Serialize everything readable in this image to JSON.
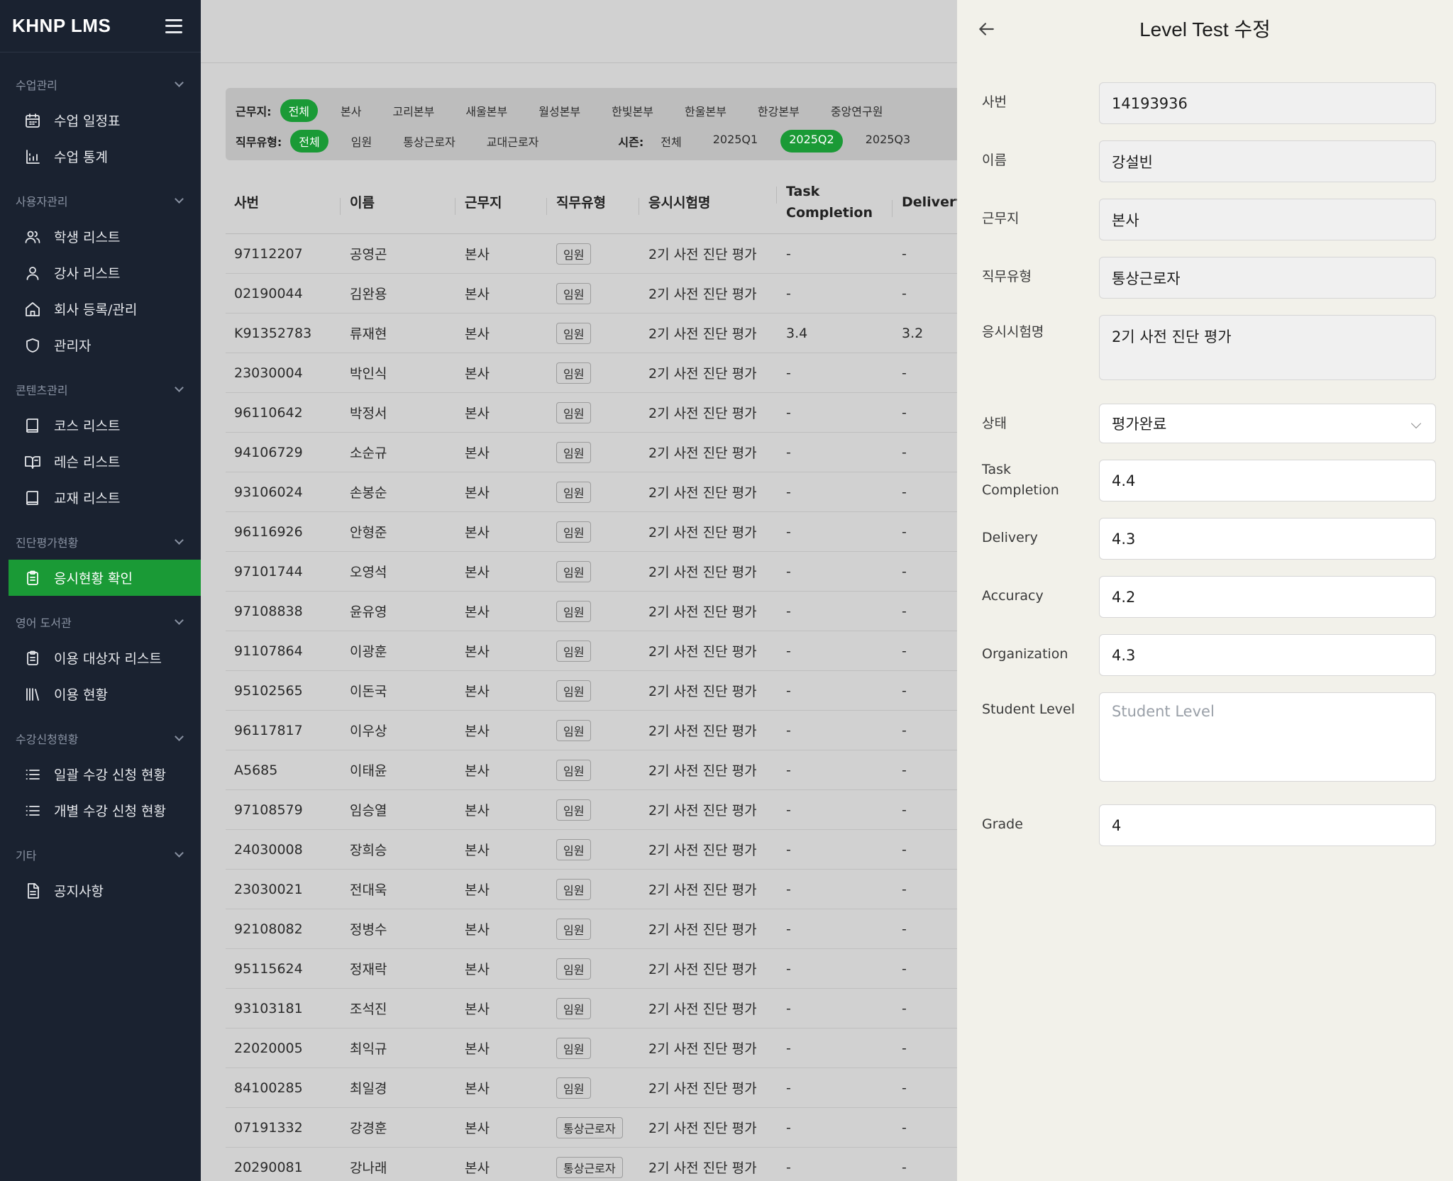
{
  "app": {
    "title": "KHNP LMS"
  },
  "sidebar": {
    "sections": [
      {
        "title": "수업관리",
        "items": [
          {
            "label": "수업 일정표",
            "icon": "calendar-icon"
          },
          {
            "label": "수업 통계",
            "icon": "chart-icon"
          }
        ]
      },
      {
        "title": "사용자관리",
        "items": [
          {
            "label": "학생 리스트",
            "icon": "users-icon"
          },
          {
            "label": "강사 리스트",
            "icon": "user-icon"
          },
          {
            "label": "회사 등록/관리",
            "icon": "home-icon"
          },
          {
            "label": "관리자",
            "icon": "shield-icon"
          }
        ]
      },
      {
        "title": "콘텐츠관리",
        "items": [
          {
            "label": "코스 리스트",
            "icon": "book-icon"
          },
          {
            "label": "레슨 리스트",
            "icon": "book-open-icon"
          },
          {
            "label": "교재 리스트",
            "icon": "book-icon"
          }
        ]
      },
      {
        "title": "진단평가현황",
        "items": [
          {
            "label": "응시현황 확인",
            "icon": "clipboard-icon",
            "active": true
          }
        ]
      },
      {
        "title": "영어 도서관",
        "items": [
          {
            "label": "이용 대상자 리스트",
            "icon": "clipboard-icon"
          },
          {
            "label": "이용 현황",
            "icon": "library-icon"
          }
        ]
      },
      {
        "title": "수강신청현황",
        "items": [
          {
            "label": "일괄 수강 신청 현황",
            "icon": "list-icon"
          },
          {
            "label": "개별 수강 신청 현황",
            "icon": "list-icon"
          }
        ]
      },
      {
        "title": "기타",
        "items": [
          {
            "label": "공지사항",
            "icon": "document-icon"
          }
        ]
      }
    ]
  },
  "filters": {
    "workplace": {
      "label": "근무지:",
      "options": [
        "전체",
        "본사",
        "고리본부",
        "새울본부",
        "월성본부",
        "한빛본부",
        "한울본부",
        "한강본부",
        "중앙연구원"
      ],
      "selected": "전체"
    },
    "job_type": {
      "label": "직무유형:",
      "options": [
        "전체",
        "임원",
        "통상근로자",
        "교대근로자"
      ],
      "selected": "전체"
    },
    "season": {
      "label": "시즌:",
      "options": [
        "전체",
        "2025Q1",
        "2025Q2",
        "2025Q3"
      ],
      "selected": "2025Q2"
    }
  },
  "table": {
    "columns": [
      "사번",
      "이름",
      "근무지",
      "직무유형",
      "응시시험명",
      "Task Completion",
      "Delivery"
    ],
    "rows": [
      [
        "97112207",
        "공영곤",
        "본사",
        "임원",
        "2기 사전 진단 평가",
        "-",
        "-"
      ],
      [
        "02190044",
        "김완용",
        "본사",
        "임원",
        "2기 사전 진단 평가",
        "-",
        "-"
      ],
      [
        "K91352783",
        "류재현",
        "본사",
        "임원",
        "2기 사전 진단 평가",
        "3.4",
        "3.2"
      ],
      [
        "23030004",
        "박인식",
        "본사",
        "임원",
        "2기 사전 진단 평가",
        "-",
        "-"
      ],
      [
        "96110642",
        "박정서",
        "본사",
        "임원",
        "2기 사전 진단 평가",
        "-",
        "-"
      ],
      [
        "94106729",
        "소순규",
        "본사",
        "임원",
        "2기 사전 진단 평가",
        "-",
        "-"
      ],
      [
        "93106024",
        "손봉순",
        "본사",
        "임원",
        "2기 사전 진단 평가",
        "-",
        "-"
      ],
      [
        "96116926",
        "안형준",
        "본사",
        "임원",
        "2기 사전 진단 평가",
        "-",
        "-"
      ],
      [
        "97101744",
        "오영석",
        "본사",
        "임원",
        "2기 사전 진단 평가",
        "-",
        "-"
      ],
      [
        "97108838",
        "윤유영",
        "본사",
        "임원",
        "2기 사전 진단 평가",
        "-",
        "-"
      ],
      [
        "91107864",
        "이광훈",
        "본사",
        "임원",
        "2기 사전 진단 평가",
        "-",
        "-"
      ],
      [
        "95102565",
        "이돈국",
        "본사",
        "임원",
        "2기 사전 진단 평가",
        "-",
        "-"
      ],
      [
        "96117817",
        "이우상",
        "본사",
        "임원",
        "2기 사전 진단 평가",
        "-",
        "-"
      ],
      [
        "A5685",
        "이태윤",
        "본사",
        "임원",
        "2기 사전 진단 평가",
        "-",
        "-"
      ],
      [
        "97108579",
        "임승열",
        "본사",
        "임원",
        "2기 사전 진단 평가",
        "-",
        "-"
      ],
      [
        "24030008",
        "장희승",
        "본사",
        "임원",
        "2기 사전 진단 평가",
        "-",
        "-"
      ],
      [
        "23030021",
        "전대욱",
        "본사",
        "임원",
        "2기 사전 진단 평가",
        "-",
        "-"
      ],
      [
        "92108082",
        "정병수",
        "본사",
        "임원",
        "2기 사전 진단 평가",
        "-",
        "-"
      ],
      [
        "95115624",
        "정재락",
        "본사",
        "임원",
        "2기 사전 진단 평가",
        "-",
        "-"
      ],
      [
        "93103181",
        "조석진",
        "본사",
        "임원",
        "2기 사전 진단 평가",
        "-",
        "-"
      ],
      [
        "22020005",
        "최익규",
        "본사",
        "임원",
        "2기 사전 진단 평가",
        "-",
        "-"
      ],
      [
        "84100285",
        "최일경",
        "본사",
        "임원",
        "2기 사전 진단 평가",
        "-",
        "-"
      ],
      [
        "07191332",
        "강경훈",
        "본사",
        "통상근로자",
        "2기 사전 진단 평가",
        "-",
        "-"
      ],
      [
        "20290081",
        "강나래",
        "본사",
        "통상근로자",
        "2기 사전 진단 평가",
        "-",
        "-"
      ]
    ]
  },
  "panel": {
    "title": "Level Test 수정",
    "fields": {
      "employee_id": {
        "label": "사번",
        "value": "14193936"
      },
      "name": {
        "label": "이름",
        "value": "강설빈"
      },
      "workplace": {
        "label": "근무지",
        "value": "본사"
      },
      "job_type": {
        "label": "직무유형",
        "value": "통상근로자"
      },
      "exam_name": {
        "label": "응시시험명",
        "value": "2기 사전 진단 평가"
      },
      "status": {
        "label": "상태",
        "value": "평가완료"
      },
      "task_completion": {
        "label_line1": "Task",
        "label_line2": "Completion",
        "value": "4.4"
      },
      "delivery": {
        "label": "Delivery",
        "value": "4.3"
      },
      "accuracy": {
        "label": "Accuracy",
        "value": "4.2"
      },
      "organization": {
        "label": "Organization",
        "value": "4.3"
      },
      "student_level": {
        "label": "Student Level",
        "placeholder": "Student Level"
      },
      "grade": {
        "label": "Grade",
        "value": "4"
      }
    }
  },
  "colors": {
    "accent": "#1a9a36",
    "sidebar_bg": "#1a2230",
    "panel_bg": "#f2f1ea"
  }
}
